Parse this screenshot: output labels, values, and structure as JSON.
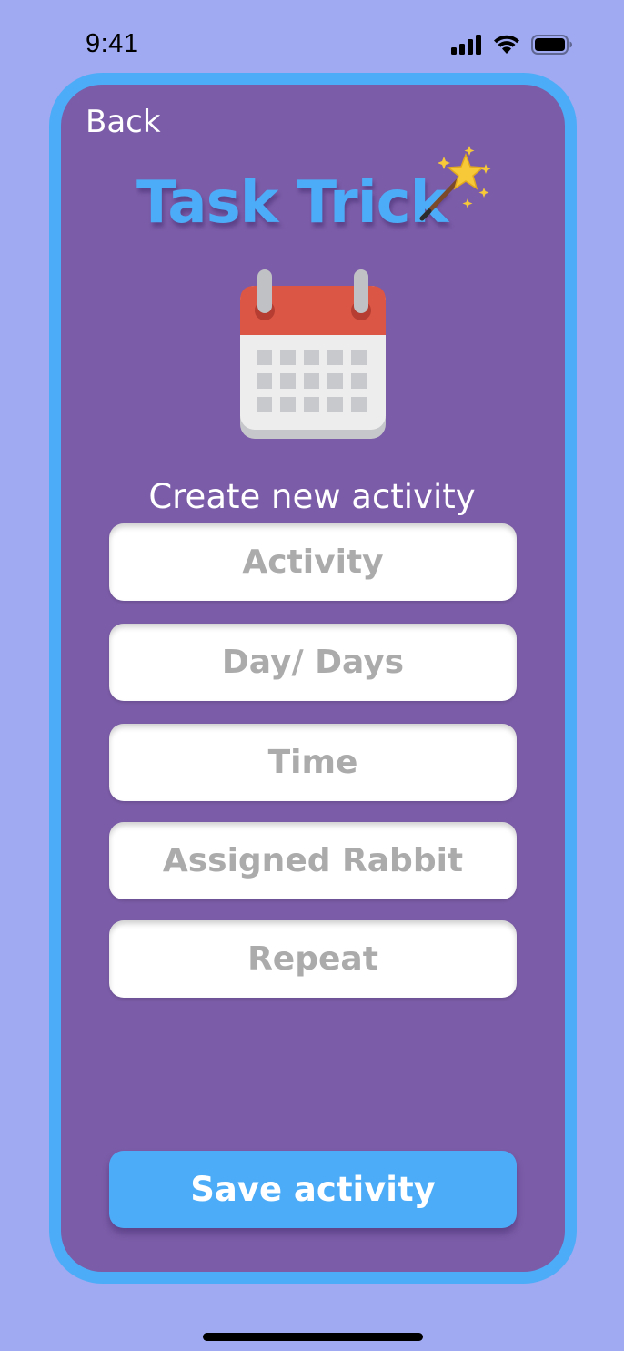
{
  "status_bar": {
    "time": "9:41",
    "icons": [
      "cellular-signal-icon",
      "wifi-icon",
      "battery-icon"
    ]
  },
  "nav": {
    "back_label": "Back"
  },
  "app": {
    "title": "Task Trick",
    "logo_icon": "magic-wand-icon"
  },
  "hero_icon": "calendar-icon",
  "form": {
    "heading": "Create new activity",
    "fields": [
      {
        "placeholder": "Activity"
      },
      {
        "placeholder": "Day/ Days"
      },
      {
        "placeholder": "Time"
      },
      {
        "placeholder": "Assigned Rabbit"
      },
      {
        "placeholder": "Repeat"
      }
    ]
  },
  "actions": {
    "save_label": "Save activity"
  },
  "colors": {
    "background": "#9FAAF2",
    "card": "#7B5CA8",
    "accent": "#4DACF7",
    "field": "#FFFFFF",
    "placeholder": "#ABABAB"
  }
}
